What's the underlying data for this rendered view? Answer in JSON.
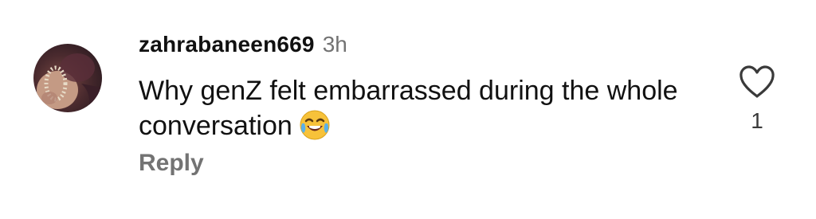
{
  "comment": {
    "username": "zahrabaneen669",
    "time": "3h",
    "text": "Why genZ felt embarrassed during the whole conversation",
    "emoji_icon": "face-with-tears-of-joy",
    "reply_label": "Reply",
    "like_count": "1",
    "like_icon": "heart-outline"
  },
  "colors": {
    "primary_text": "#111111",
    "secondary_text": "#737373",
    "background": "#ffffff"
  }
}
